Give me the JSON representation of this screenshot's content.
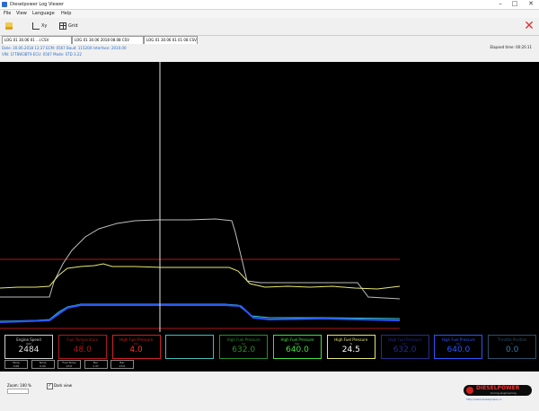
{
  "window": {
    "title": "Dieselpower Log Viewer",
    "minimize": "–",
    "maximize": "□",
    "close": "✕"
  },
  "menu": [
    "File",
    "View",
    "Language",
    "Help"
  ],
  "toolbar": {
    "open_label": "",
    "xy_label": "Xy",
    "grid_label": "Grid",
    "close_symbol": "✕"
  },
  "tabs": [
    "LOG 01 30.06 01 ...l.CSV",
    "LOG 01 30.06 2018 08.08 CSV",
    "LOG 01 30.06 01 01 08 CSV"
  ],
  "info": {
    "line1": "Date: 30.06.2018 13:37 ECM: 0567 Baud: 115200 Interface: 2010.00",
    "line2": "VIN: 1FT8W3BT9 ECU: 0567 Mode: STD 3.22",
    "right": "Elapsed time: 00:20.11"
  },
  "colors": {
    "white": "#e6e6e6",
    "yellow": "#e8e870",
    "red": "#c81e1e",
    "cyan": "#37c9c9",
    "blue": "#2a56ff",
    "green": "#40b040",
    "grey": "#7a7a7a"
  },
  "gauges": [
    {
      "name": "Engine Speed",
      "unit": "rpm",
      "value": "2484",
      "color": "#d0d0d0",
      "valcolor": "#e0e0e0"
    },
    {
      "name": "Fuel Temperature",
      "unit": "°C",
      "value": "48.0",
      "color": "#b01818",
      "valcolor": "#b01818"
    },
    {
      "name": "High Fuel Pressure",
      "unit": "bar",
      "value": "4.0",
      "color": "#d02020",
      "valcolor": "#ff3030"
    },
    {
      "name": "",
      "unit": "",
      "value": "",
      "color": "#3fbfbf",
      "valcolor": "#3fbfbf"
    },
    {
      "name": "High Fuel Pressure",
      "unit": "bar",
      "value": "632.0",
      "color": "#2a8f2a",
      "valcolor": "#2a8f2a"
    },
    {
      "name": "High Fuel Pressure",
      "unit": "bar",
      "value": "640.0",
      "color": "#40e040",
      "valcolor": "#40e040"
    },
    {
      "name": "High Fuel Pressure",
      "unit": "%",
      "value": "24.5",
      "color": "#e8e870",
      "valcolor": "#ffffff"
    },
    {
      "name": "High Fuel Pressure",
      "unit": "bar",
      "value": "632.0",
      "color": "#232f88",
      "valcolor": "#232f88"
    },
    {
      "name": "High Fuel Pressure",
      "unit": "bar",
      "value": "640.0",
      "color": "#2a56ff",
      "valcolor": "#2a56ff"
    },
    {
      "name": "Throttle Position",
      "unit": "%",
      "value": "0.0",
      "color": "#28506a",
      "valcolor": "#3a7aa8"
    }
  ],
  "mini_gauges": [
    {
      "label": "Temp",
      "value": "0.00"
    },
    {
      "label": "Temp",
      "value": "0.00"
    },
    {
      "label": "Fuel Temp",
      "value": "23.0"
    },
    {
      "label": "Bar",
      "value": "1.37"
    },
    {
      "label": "Bar",
      "value": "23.0"
    }
  ],
  "bottom": {
    "zoom_label": "Zoom: 100 %",
    "checkbox_label": "Dark view",
    "logo_brand": "DIESELPOWER",
    "logo_sub": "tuning-engineering",
    "url": "http://www.dieselpower.co"
  }
}
